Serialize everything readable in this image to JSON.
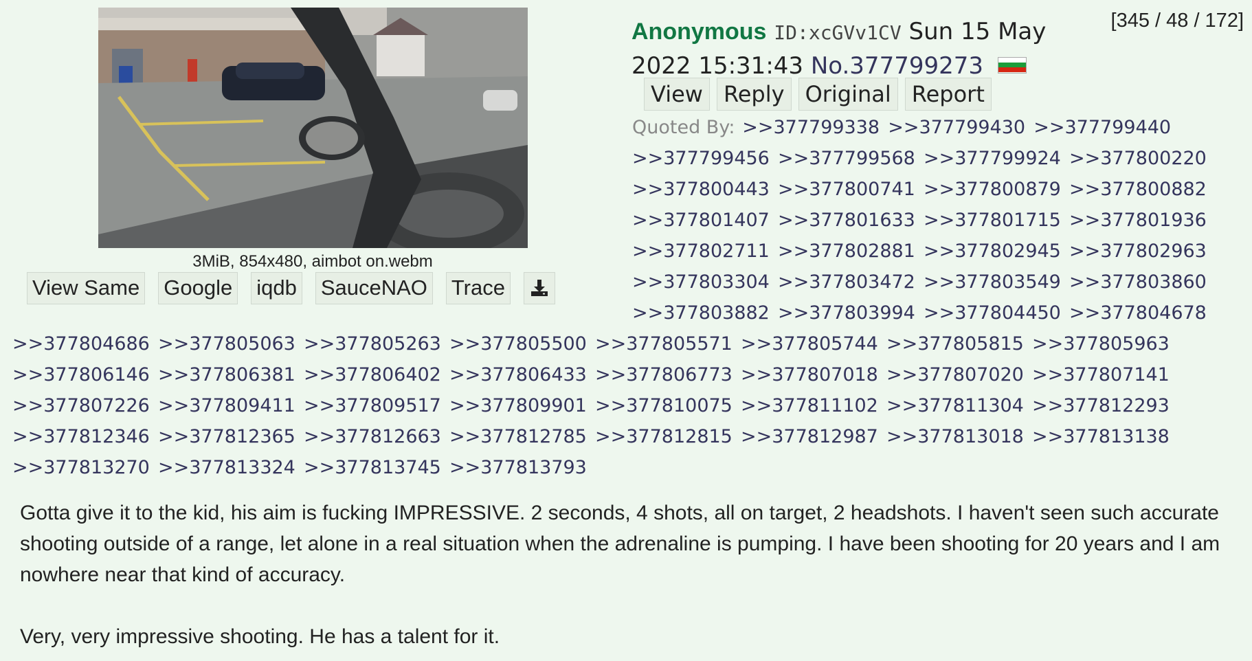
{
  "thread_counts": "[345 / 48 / 172]",
  "file": {
    "info": "3MiB, 854x480, aimbot on.webm",
    "tools": [
      "View Same",
      "Google",
      "iqdb",
      "SauceNAO",
      "Trace"
    ],
    "download_icon": "download-icon"
  },
  "post": {
    "name": "Anonymous",
    "id": "ID:xcGVv1CV",
    "date_part1": "Sun 15 May",
    "date_part2": "2022 15:31:43",
    "number": "No.377799273",
    "flag": "flag-icon",
    "flag_colors": [
      "#ffffff",
      "#1c9d3a",
      "#d62612"
    ],
    "actions": [
      "View",
      "Reply",
      "Original",
      "Report"
    ]
  },
  "quoted_by": {
    "label": "Quoted By:",
    "links": [
      ">>377799338",
      ">>377799430",
      ">>377799440",
      ">>377799456",
      ">>377799568",
      ">>377799924",
      ">>377800220",
      ">>377800443",
      ">>377800741",
      ">>377800879",
      ">>377800882",
      ">>377801407",
      ">>377801633",
      ">>377801715",
      ">>377801936",
      ">>377802711",
      ">>377802881",
      ">>377802945",
      ">>377802963",
      ">>377803304",
      ">>377803472",
      ">>377803549",
      ">>377803860",
      ">>377803882",
      ">>377803994",
      ">>377804450",
      ">>377804678",
      ">>377804686",
      ">>377805063",
      ">>377805263",
      ">>377805500",
      ">>377805571",
      ">>377805744",
      ">>377805815",
      ">>377805963",
      ">>377806146",
      ">>377806381",
      ">>377806402",
      ">>377806433",
      ">>377806773",
      ">>377807018",
      ">>377807020",
      ">>377807141",
      ">>377807226",
      ">>377809411",
      ">>377809517",
      ">>377809901",
      ">>377810075",
      ">>377811102",
      ">>377811304",
      ">>377812293",
      ">>377812346",
      ">>377812365",
      ">>377812663",
      ">>377812785",
      ">>377812815",
      ">>377812987",
      ">>377813018",
      ">>377813138",
      ">>377813270",
      ">>377813324",
      ">>377813745",
      ">>377813793"
    ]
  },
  "body": {
    "paragraph1": "Gotta give it to the kid, his aim is fucking IMPRESSIVE. 2 seconds, 4 shots, all on target, 2 headshots. I haven't seen such accurate shooting outside of a range, let alone in a real situation when the adrenaline is pumping. I have been shooting for 20 years and I am nowhere near that kind of accuracy.",
    "paragraph2": "Very, very impressive shooting. He has a talent for it."
  }
}
